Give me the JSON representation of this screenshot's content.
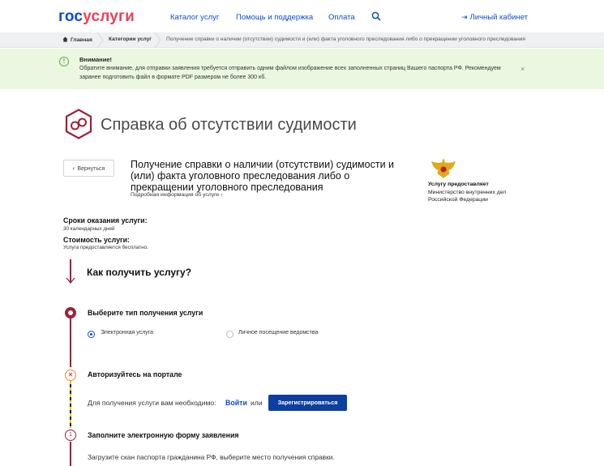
{
  "header": {
    "logo_part1": "гос",
    "logo_part2": "услуги",
    "nav": [
      "Каталог услуг",
      "Помощь и поддержка",
      "Оплата"
    ],
    "account_label": "Личный кабинет",
    "icons": [
      "search-icon",
      "login-arrow-icon"
    ]
  },
  "breadcrumbs": {
    "home": "Главная",
    "categories": "Категории услуг",
    "current": "Получение справки о наличии (отсутствии) судимости и (или) факта уголовного преследования либо о прекращении уголовного преследования"
  },
  "alert": {
    "title": "Внимание!",
    "text": "Обратите внимание, для отправки заявления требуется отправить одним файлом изображение всех заполненных страниц Вашего паспорта РФ. Рекомендуем заранее подготовить файл в формате PDF размером не более 300 кб.",
    "close": "×"
  },
  "page": {
    "title": "Справка об отсутствии судимости",
    "back_label": "Вернуться",
    "subtitle": "Получение справки о наличии (отсутствии) судимости и (или) факта уголовного преследования либо о прекращении уголовного преследования",
    "more_info": "Подробная информация об услуге",
    "provider_label": "Услугу предоставляет",
    "provider_name": "Министерство внутренних дел Российской Федерации",
    "terms_label": "Сроки оказания услуги:",
    "terms_value": "30 календарных дней",
    "cost_label": "Стоимость услуги:",
    "cost_value": "Услуга предоставляется бесплатно."
  },
  "steps": {
    "how_title": "Как получить услугу?",
    "step1_title": "Выберите тип получения услуги",
    "option_electronic": "Электронная услуга",
    "option_personal": "Личное посещение ведомства",
    "selected_option": "Электронная услуга",
    "step2_title": "Авторизуйтесь на портале",
    "auth_text": "Для получения услуги вам необходимо:",
    "login_link": "Войти",
    "or_text": "или",
    "register_button": "Зарегистрироваться",
    "step3_number": "1",
    "step3_title": "Заполните электронную форму заявления",
    "step3_desc": "Загрузите скан паспорта гражданина РФ, выберите место получения справки."
  },
  "colors": {
    "brand_blue": "#0d4cd3",
    "brand_red": "#ee3f58",
    "accent_maroon": "#9c2138",
    "alert_bg": "#ebf7e1",
    "button_blue": "#0d3f9e"
  }
}
